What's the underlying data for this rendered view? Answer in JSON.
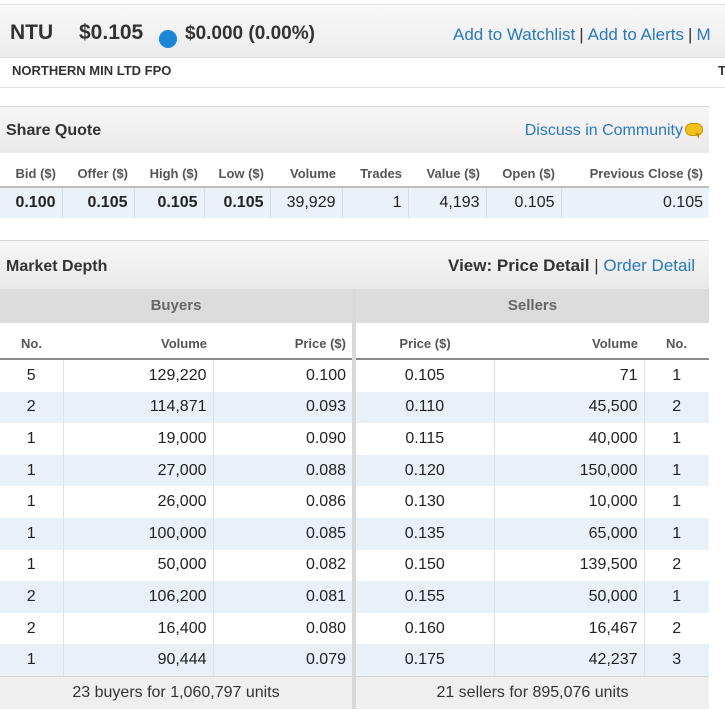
{
  "header": {
    "code": "NTU",
    "price": "$0.105",
    "change": "$0.000 (0.00%)",
    "status_color": "#1a87d8",
    "actions": [
      "Add to Watchlist",
      "Add to Alerts",
      "M"
    ],
    "company_name": "NORTHERN MIN LTD FPO",
    "right_fragment": "T"
  },
  "share_quote": {
    "title": "Share Quote",
    "discuss_link": "Discuss in Community",
    "columns": [
      "Bid ($)",
      "Offer ($)",
      "High ($)",
      "Low ($)",
      "Volume",
      "Trades",
      "Value ($)",
      "Open ($)",
      "Previous Close ($)"
    ],
    "values": [
      "0.100",
      "0.105",
      "0.105",
      "0.105",
      "39,929",
      "1",
      "4,193",
      "0.105",
      "0.105"
    ]
  },
  "market_depth": {
    "title": "Market Depth",
    "view_label": "View:",
    "view_active": "Price Detail",
    "view_other": "Order Detail",
    "buyers_label": "Buyers",
    "sellers_label": "Sellers",
    "buyer_columns": [
      "No.",
      "Volume",
      "Price ($)"
    ],
    "seller_columns": [
      "Price ($)",
      "Volume",
      "No."
    ],
    "buyers": [
      [
        "5",
        "129,220",
        "0.100"
      ],
      [
        "2",
        "114,871",
        "0.093"
      ],
      [
        "1",
        "19,000",
        "0.090"
      ],
      [
        "1",
        "27,000",
        "0.088"
      ],
      [
        "1",
        "26,000",
        "0.086"
      ],
      [
        "1",
        "100,000",
        "0.085"
      ],
      [
        "1",
        "50,000",
        "0.082"
      ],
      [
        "2",
        "106,200",
        "0.081"
      ],
      [
        "2",
        "16,400",
        "0.080"
      ],
      [
        "1",
        "90,444",
        "0.079"
      ]
    ],
    "sellers": [
      [
        "0.105",
        "71",
        "1"
      ],
      [
        "0.110",
        "45,500",
        "2"
      ],
      [
        "0.115",
        "40,000",
        "1"
      ],
      [
        "0.120",
        "150,000",
        "1"
      ],
      [
        "0.130",
        "10,000",
        "1"
      ],
      [
        "0.135",
        "65,000",
        "1"
      ],
      [
        "0.150",
        "139,500",
        "2"
      ],
      [
        "0.155",
        "50,000",
        "1"
      ],
      [
        "0.160",
        "16,467",
        "2"
      ],
      [
        "0.175",
        "42,237",
        "3"
      ]
    ],
    "buyers_total": "23 buyers for 1,060,797 units",
    "sellers_total": "21 sellers for 895,076 units"
  }
}
